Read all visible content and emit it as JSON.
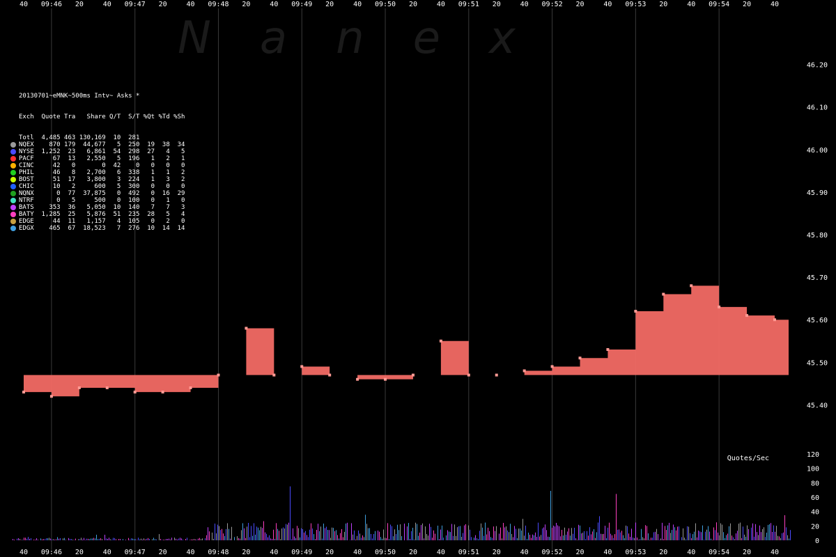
{
  "watermark": "Nanex",
  "chart_title": "20130701~eMNK~500ms Intv~ Asks *",
  "legend_header": [
    "Exch",
    "Quote",
    "Tra",
    "Share",
    "Q/T",
    "S/T",
    "%Qt",
    "%Td",
    "%Sh"
  ],
  "legend_rows": [
    {
      "exch": "Totl",
      "color": "",
      "quote": "4,485",
      "tra": "463",
      "share": "130,169",
      "qt": "10",
      "st": "281",
      "pqt": "",
      "ptd": "",
      "psh": ""
    },
    {
      "exch": "NQEX",
      "color": "#9a9a9a",
      "quote": "870",
      "tra": "179",
      "share": "44,677",
      "qt": "5",
      "st": "250",
      "pqt": "19",
      "ptd": "38",
      "psh": "34"
    },
    {
      "exch": "NYSE",
      "color": "#4b4bff",
      "quote": "1,252",
      "tra": "23",
      "share": "6,861",
      "qt": "54",
      "st": "298",
      "pqt": "27",
      "ptd": "4",
      "psh": "5"
    },
    {
      "exch": "PACF",
      "color": "#ff3030",
      "quote": "67",
      "tra": "13",
      "share": "2,550",
      "qt": "5",
      "st": "196",
      "pqt": "1",
      "ptd": "2",
      "psh": "1"
    },
    {
      "exch": "CINC",
      "color": "#ffb000",
      "quote": "42",
      "tra": "0",
      "share": "0",
      "qt": "42",
      "st": "0",
      "pqt": "0",
      "ptd": "0",
      "psh": "0"
    },
    {
      "exch": "PHIL",
      "color": "#20d020",
      "quote": "46",
      "tra": "8",
      "share": "2,700",
      "qt": "6",
      "st": "338",
      "pqt": "1",
      "ptd": "1",
      "psh": "2"
    },
    {
      "exch": "BOST",
      "color": "#c8ff00",
      "quote": "51",
      "tra": "17",
      "share": "3,800",
      "qt": "3",
      "st": "224",
      "pqt": "1",
      "ptd": "3",
      "psh": "2"
    },
    {
      "exch": "CHIC",
      "color": "#2060ff",
      "quote": "10",
      "tra": "2",
      "share": "600",
      "qt": "5",
      "st": "300",
      "pqt": "0",
      "ptd": "0",
      "psh": "0"
    },
    {
      "exch": "NQNX",
      "color": "#20a020",
      "quote": "0",
      "tra": "77",
      "share": "37,875",
      "qt": "0",
      "st": "492",
      "pqt": "0",
      "ptd": "16",
      "psh": "29"
    },
    {
      "exch": "NTRF",
      "color": "#40e0c0",
      "quote": "0",
      "tra": "5",
      "share": "500",
      "qt": "0",
      "st": "100",
      "pqt": "0",
      "ptd": "1",
      "psh": "0"
    },
    {
      "exch": "BATS",
      "color": "#c040ff",
      "quote": "353",
      "tra": "36",
      "share": "5,050",
      "qt": "10",
      "st": "140",
      "pqt": "7",
      "ptd": "7",
      "psh": "3"
    },
    {
      "exch": "BATY",
      "color": "#ff40c0",
      "quote": "1,285",
      "tra": "25",
      "share": "5,876",
      "qt": "51",
      "st": "235",
      "pqt": "28",
      "ptd": "5",
      "psh": "4"
    },
    {
      "exch": "EDGE",
      "color": "#c8a040",
      "quote": "44",
      "tra": "11",
      "share": "1,157",
      "qt": "4",
      "st": "105",
      "pqt": "0",
      "ptd": "2",
      "psh": "0"
    },
    {
      "exch": "EDGX",
      "color": "#40a0e0",
      "quote": "465",
      "tra": "67",
      "share": "18,523",
      "qt": "7",
      "st": "276",
      "pqt": "10",
      "ptd": "14",
      "psh": "14"
    }
  ],
  "chart_data": {
    "type": "line",
    "title": "20130701~eMNK~500ms Intv~ Asks *",
    "x_ticks": [
      "40",
      "09:46",
      "20",
      "40",
      "09:47",
      "20",
      "40",
      "09:48",
      "20",
      "40",
      "09:49",
      "20",
      "40",
      "09:50",
      "20",
      "40",
      "09:51",
      "20",
      "40",
      "09:52",
      "20",
      "40",
      "09:53",
      "20",
      "40",
      "09:54",
      "20",
      "40"
    ],
    "y_ticks": [
      "46.20",
      "46.10",
      "46.00",
      "45.90",
      "45.80",
      "45.70",
      "45.60",
      "45.50",
      "45.40"
    ],
    "ylim": [
      45.35,
      46.25
    ],
    "volume_label": "Quotes/Sec",
    "volume_ticks": [
      "120",
      "100",
      "80",
      "60",
      "40",
      "20",
      "0"
    ],
    "volume_ylim": [
      0,
      120
    ],
    "series": [
      {
        "x": [
          "09:45:40",
          "09:46:00",
          "09:46:20",
          "09:46:40",
          "09:47:00",
          "09:47:20",
          "09:47:40",
          "09:48:00",
          "09:48:20",
          "09:48:40",
          "09:49:00",
          "09:49:20",
          "09:49:40",
          "09:50:00",
          "09:50:20",
          "09:50:40",
          "09:51:00",
          "09:51:20",
          "09:51:40",
          "09:52:00",
          "09:52:20",
          "09:52:40",
          "09:53:00",
          "09:53:20",
          "09:53:40",
          "09:54:00",
          "09:54:20",
          "09:54:40"
        ],
        "values": [
          45.43,
          45.42,
          45.44,
          45.44,
          45.43,
          45.43,
          45.44,
          45.47,
          45.58,
          45.47,
          45.49,
          45.47,
          45.46,
          45.46,
          45.47,
          45.55,
          45.47,
          45.47,
          45.48,
          45.49,
          45.51,
          45.53,
          45.62,
          45.66,
          45.68,
          45.63,
          45.61,
          45.6
        ]
      }
    ]
  }
}
